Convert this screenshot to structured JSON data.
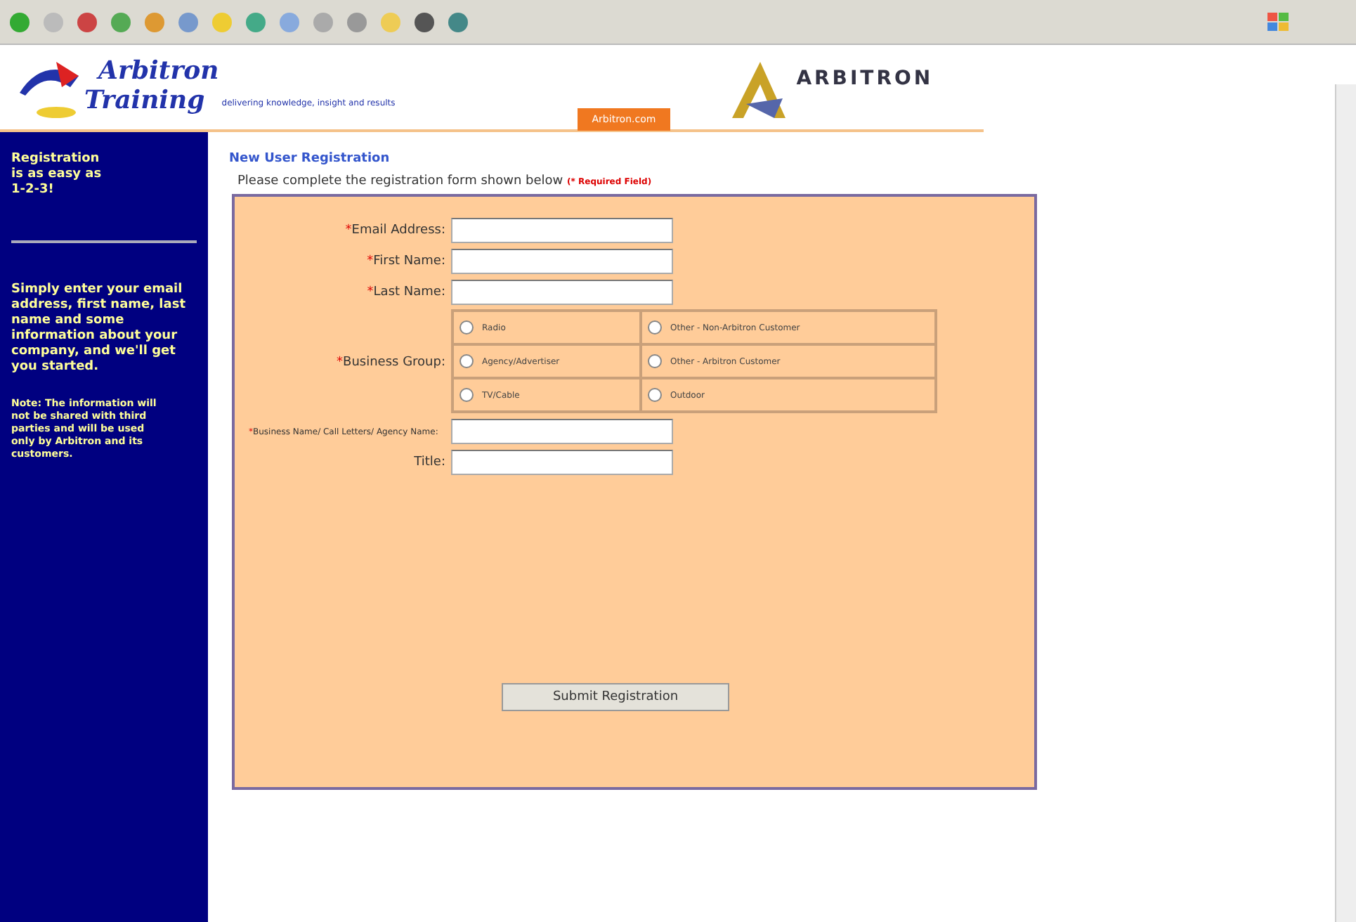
{
  "header": {
    "logo_top": "Arbitron",
    "logo_bottom": "Training",
    "tagline": "delivering knowledge, insight and results",
    "brand": "ARBITRON",
    "site_link": "Arbitron.com"
  },
  "sidebar": {
    "headline": "Registration is as easy as 1-2-3!",
    "intro": "Simply enter your email address, first name, last name and some information about your company, and we'll get you started.",
    "note": "Note: The information will not be shared with third parties and will be used only by Arbitron and its customers."
  },
  "form": {
    "title": "New User Registration",
    "instruction": "Please complete the registration form shown below",
    "required_note": "(* Required Field)",
    "required_mark": "*",
    "fields": [
      {
        "kind": "text",
        "label": "Email Address:",
        "required": true
      },
      {
        "kind": "text",
        "label": "First Name:",
        "required": true
      },
      {
        "kind": "text",
        "label": "Last Name:",
        "required": true
      },
      {
        "kind": "radio",
        "label": "Business Group:",
        "required": true,
        "options": [
          {
            "label": "Radio",
            "selected": false
          },
          {
            "label": "Other - Non-Arbitron Customer",
            "selected": false
          },
          {
            "label": "Agency/Advertiser",
            "selected": false
          },
          {
            "label": "Other - Arbitron Customer",
            "selected": false
          },
          {
            "label": "TV/Cable",
            "selected": false
          },
          {
            "label": "Outdoor",
            "selected": false
          }
        ]
      },
      {
        "kind": "text_small",
        "label": "Business Name/ Call Letters/ Agency Name:",
        "required": true
      },
      {
        "kind": "text",
        "label": "Title:",
        "required": false
      }
    ],
    "submit": "Submit Registration"
  }
}
